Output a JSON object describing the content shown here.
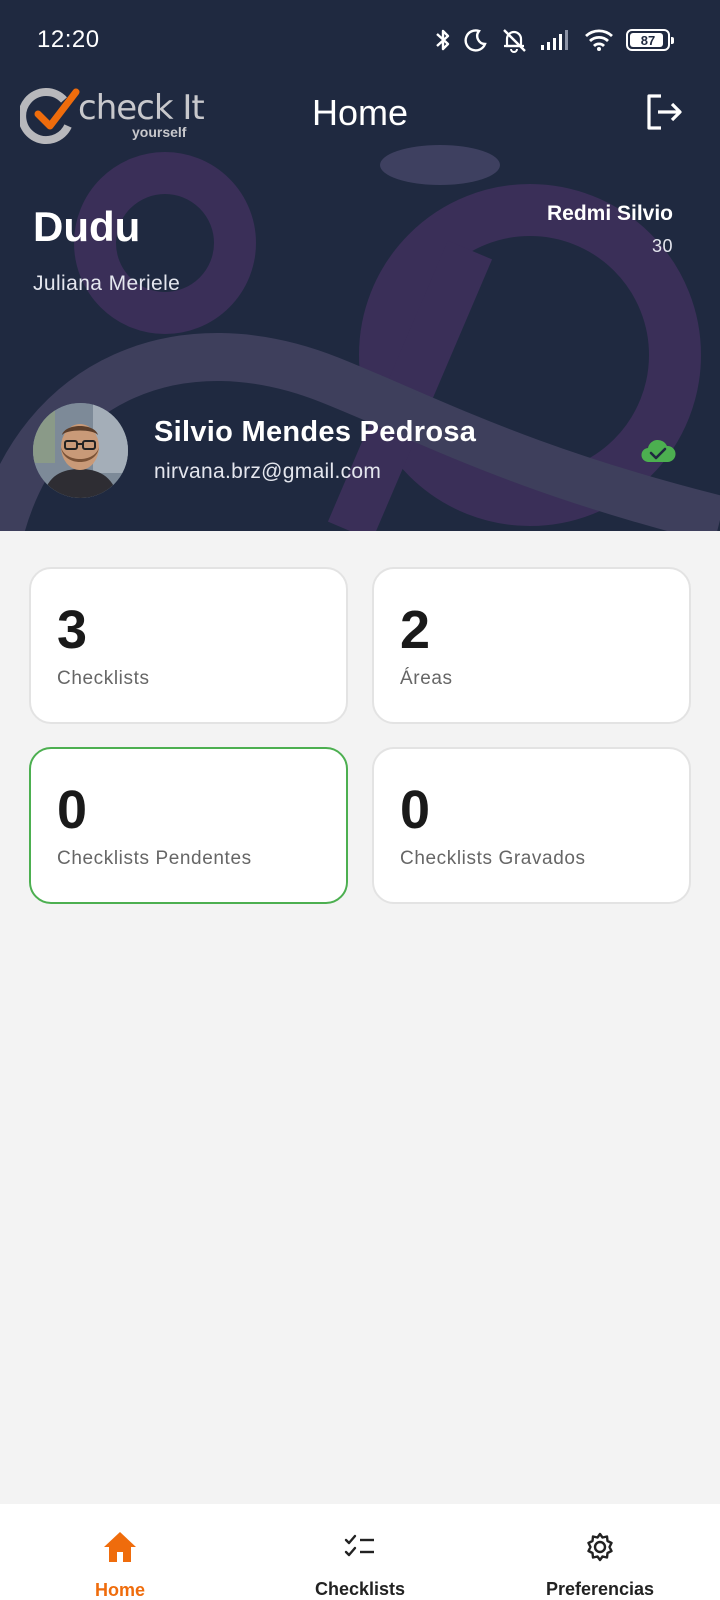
{
  "status_bar": {
    "time": "12:20",
    "battery": "87",
    "icons": [
      "bluetooth-icon",
      "moon-icon",
      "silent-bell-icon",
      "signal-icon",
      "wifi-icon",
      "battery-icon"
    ]
  },
  "app_bar": {
    "logo_text": "check It",
    "logo_subtext": "yourself",
    "title": "Home",
    "logout_icon": "logout-icon"
  },
  "header": {
    "company": "Dudu",
    "subcompany": "Juliana Meriele",
    "device_name": "Redmi Silvio",
    "device_count": "30",
    "user": {
      "name": "Silvio Mendes Pedrosa",
      "email": "nirvana.brz@gmail.com"
    },
    "sync_status_icon": "cloud-check-icon"
  },
  "cards": [
    {
      "value": "3",
      "label": "Checklists"
    },
    {
      "value": "2",
      "label": "Áreas"
    },
    {
      "value": "0",
      "label": "Checklists Pendentes"
    },
    {
      "value": "0",
      "label": "Checklists Gravados"
    }
  ],
  "bottom_nav": {
    "items": [
      {
        "label": "Home",
        "icon": "home-icon",
        "active": true
      },
      {
        "label": "Checklists",
        "icon": "checklist-icon",
        "active": false
      },
      {
        "label": "Preferencias",
        "icon": "gear-icon",
        "active": false
      }
    ]
  },
  "colors": {
    "header_bg": "#1f2940",
    "accent_orange": "#ef6c0c",
    "success_green": "#4caf50",
    "page_bg": "#f3f3f3"
  }
}
